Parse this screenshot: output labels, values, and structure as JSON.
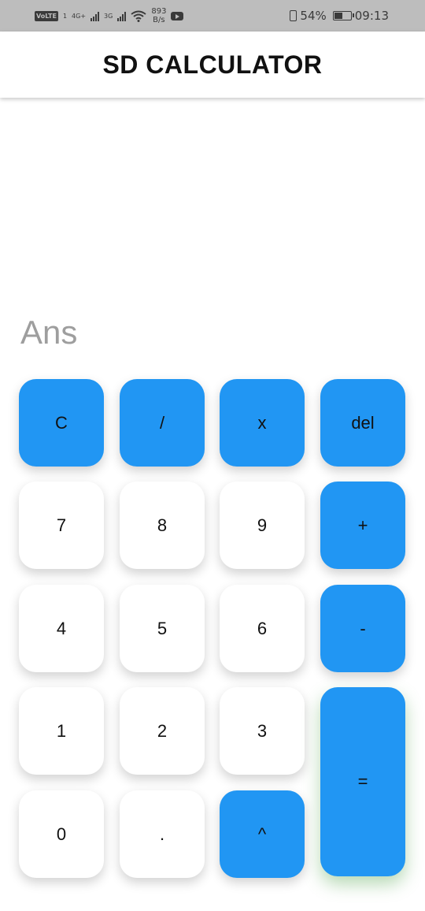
{
  "status_bar": {
    "volte": "VoLTE",
    "sim1": "1",
    "net1": "4G+",
    "net2": "3G",
    "speed_value": "893",
    "speed_unit": "B/s",
    "battery_percent": "54%",
    "battery_level": 0.54,
    "time": "09:13"
  },
  "app": {
    "title": "SD CALCULATOR"
  },
  "display": {
    "result_placeholder": "Ans"
  },
  "keypad": {
    "clear": "C",
    "divide": "/",
    "multiply": "x",
    "delete": "del",
    "seven": "7",
    "eight": "8",
    "nine": "9",
    "plus": "+",
    "four": "4",
    "five": "5",
    "six": "6",
    "minus": "-",
    "one": "1",
    "two": "2",
    "three": "3",
    "equals": "=",
    "zero": "0",
    "decimal": ".",
    "power": "^"
  },
  "colors": {
    "accent": "#2196f3",
    "key_light": "#ffffff",
    "status_bar": "#bdbdbd",
    "placeholder_text": "#9e9e9e"
  }
}
